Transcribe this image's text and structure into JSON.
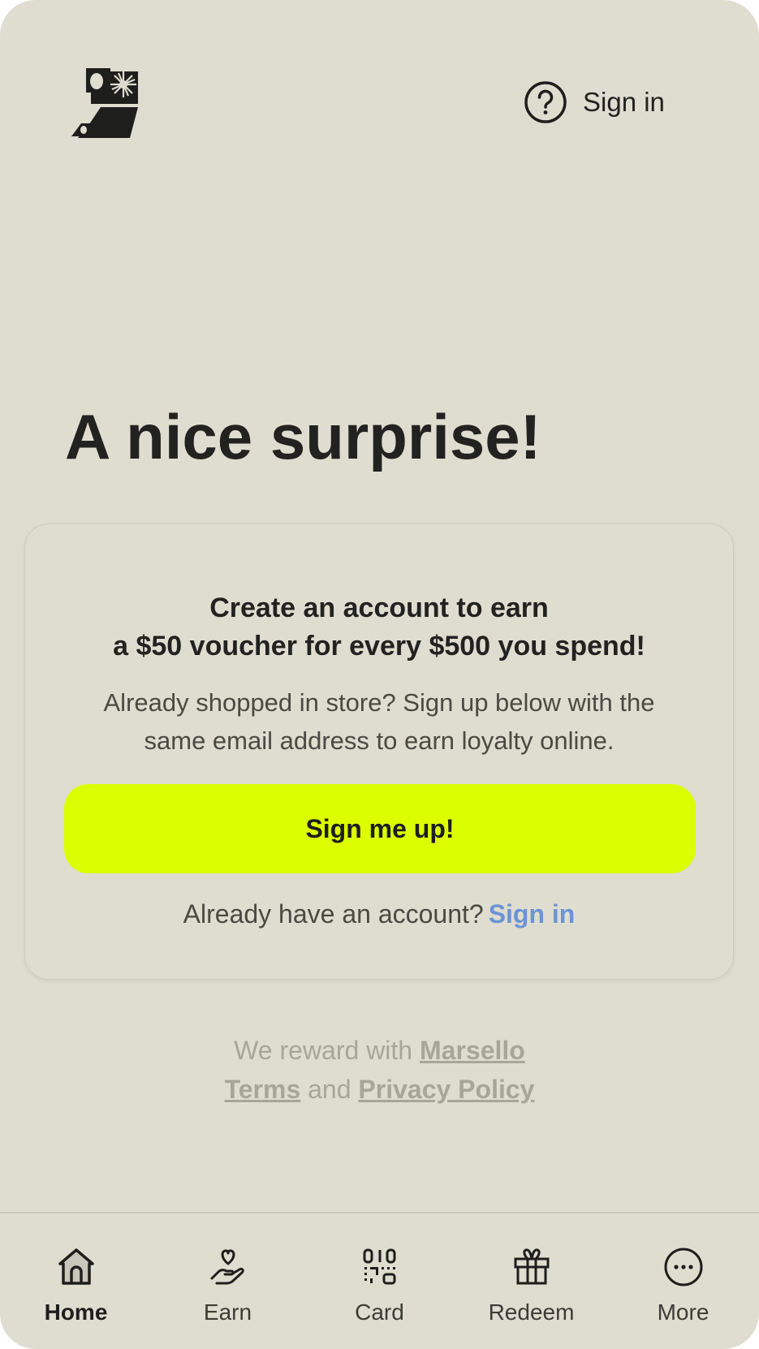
{
  "header": {
    "logo": "brand-logo",
    "help_icon": "question-circle-icon",
    "signin_label": "Sign in"
  },
  "hero": {
    "headline": "A nice surprise!"
  },
  "signup_card": {
    "title_line1": "Create an account to earn",
    "title_line2": "a $50 voucher for every $500 you spend!",
    "body_line1": "Already shopped in store? Sign up below with the",
    "body_line2": "same email address to earn loyalty online.",
    "button_label": "Sign me up!",
    "have_account_text": "Already have an account?",
    "signin_link": "Sign in"
  },
  "footer": {
    "reward_prefix": "We reward with",
    "reward_brand": "Marsello",
    "terms_label": "Terms",
    "and_text": "and",
    "privacy_label": "Privacy Policy"
  },
  "bottom_nav": {
    "active": "Home",
    "items": [
      {
        "label": "Home",
        "icon": "home-icon"
      },
      {
        "label": "Earn",
        "icon": "hand-heart-icon"
      },
      {
        "label": "Card",
        "icon": "qr-code-icon"
      },
      {
        "label": "Redeem",
        "icon": "gift-icon"
      },
      {
        "label": "More",
        "icon": "more-dots-icon"
      }
    ]
  },
  "colors": {
    "background": "#dfddd0",
    "accent_button": "#dcff00",
    "link": "#6b94d6",
    "text": "#222220",
    "muted": "#a8a699"
  }
}
